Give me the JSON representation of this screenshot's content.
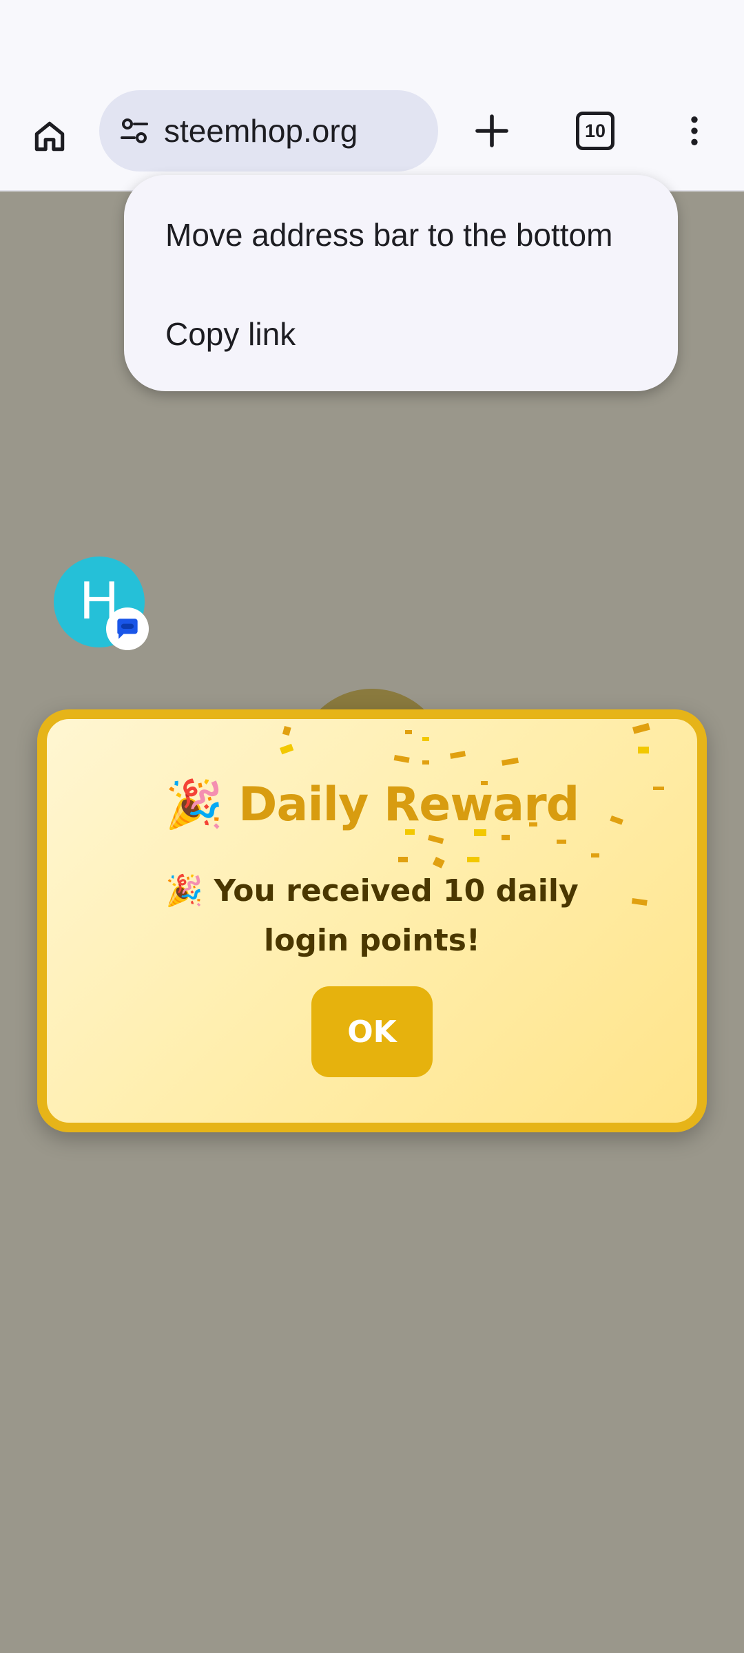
{
  "browser": {
    "url": "steemhop.org",
    "tab_count": "10"
  },
  "menu": {
    "items": [
      {
        "label": "Move address bar to the bottom"
      },
      {
        "label": "Copy link"
      }
    ]
  },
  "chat_head": {
    "letter": "H"
  },
  "dialog": {
    "title_emoji": "🎉",
    "title": "Daily Reward",
    "message_emoji": "🎉",
    "message": "You received 10 daily login points!",
    "ok_label": "OK"
  },
  "colors": {
    "accent": "#e6b418",
    "title": "#d89c10",
    "ok_button": "#e6b20d",
    "chat_head": "#25c0d8"
  }
}
